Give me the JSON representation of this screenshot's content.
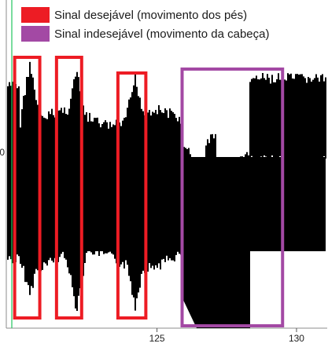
{
  "chart_data": {
    "type": "line",
    "title": "",
    "xlabel": "",
    "ylabel": "",
    "x_ticks": [
      125,
      130
    ],
    "y_ticks": [
      0
    ],
    "xlim": [
      119.6,
      131.1
    ],
    "legend": {
      "placement": "top-left",
      "entries": [
        {
          "label": "Sinal desejável (movimento dos pés)",
          "color": "#ed1c24"
        },
        {
          "label": "Sinal indesejável (movimento da cabeça)",
          "color": "#a349a4"
        }
      ]
    },
    "highlighted_regions": [
      {
        "category": "desejavel",
        "x_range": [
          119.9,
          120.8
        ]
      },
      {
        "category": "desejavel",
        "x_range": [
          121.4,
          122.3
        ]
      },
      {
        "category": "desejavel",
        "x_range": [
          123.6,
          124.6
        ]
      },
      {
        "category": "indesejavel",
        "x_range": [
          125.9,
          129.5
        ]
      }
    ],
    "signal_color": "#000000",
    "cursor_line_color": "#22c55e"
  }
}
